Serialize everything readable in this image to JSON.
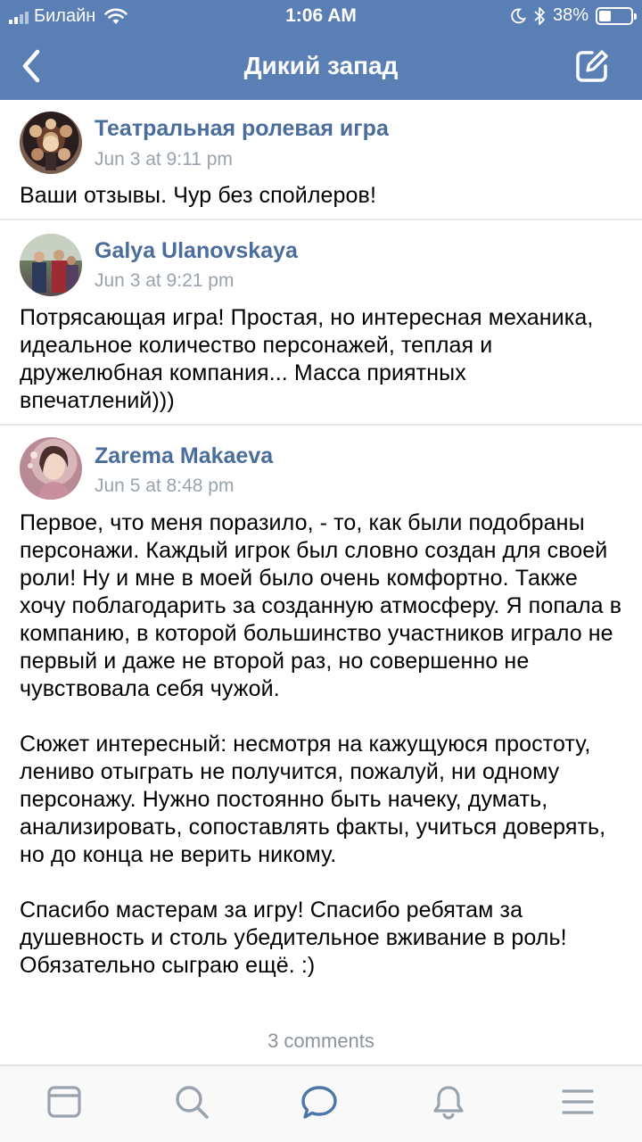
{
  "status_bar": {
    "carrier": "Билайн",
    "time": "1:06 AM",
    "battery_percent": "38%",
    "battery_level": 0.38,
    "icons": [
      "signal-icon",
      "wifi-icon",
      "moon-icon",
      "bluetooth-icon",
      "battery-icon"
    ]
  },
  "nav": {
    "title": "Дикий запад",
    "back_icon": "chevron-left-icon",
    "edit_icon": "compose-icon",
    "color": "#5a7fb5"
  },
  "posts": [
    {
      "author": "Театральная ролевая игра",
      "date": "Jun 3 at 9:11 pm",
      "paragraphs": [
        "Ваши отзывы. Чур без спойлеров!"
      ]
    },
    {
      "author": "Galya Ulanovskaya",
      "date": "Jun 3 at 9:21 pm",
      "paragraphs": [
        "Потрясающая игра! Простая, но интересная механика, идеальное количество персонажей, теплая и дружелюбная компания... Масса приятных впечатлений)))"
      ]
    },
    {
      "author": "Zarema Makaeva",
      "date": "Jun 5 at 8:48 pm",
      "paragraphs": [
        "Первое, что меня поразило, - то, как были подобраны персонажи. Каждый игрок был словно создан для своей роли! Ну и мне в моей было очень комфортно. Также хочу поблагодарить за созданную атмосферу. Я попала в компанию, в которой большинство участников играло не первый и даже не второй раз, но совершенно не чувствовала себя чужой.",
        "Сюжет интересный: несмотря на кажущуюся простоту, лениво отыграть не получится, пожалуй, ни одному персонажу. Нужно постоянно быть начеку, думать, анализировать, сопоставлять факты, учиться доверять, но до конца не верить никому.",
        "Спасибо мастерам за игру! Спасибо ребятам за душевность и столь убедительное вживание в роль! Обязательно сыграю ещё. :)"
      ]
    }
  ],
  "comments_count": "3 comments",
  "tab_bar": {
    "tabs": [
      "news-icon",
      "search-icon",
      "messages-icon",
      "notifications-icon",
      "menu-icon"
    ],
    "active": "messages-icon",
    "active_color": "#4a76a8",
    "inactive_color": "#99a2ad"
  }
}
